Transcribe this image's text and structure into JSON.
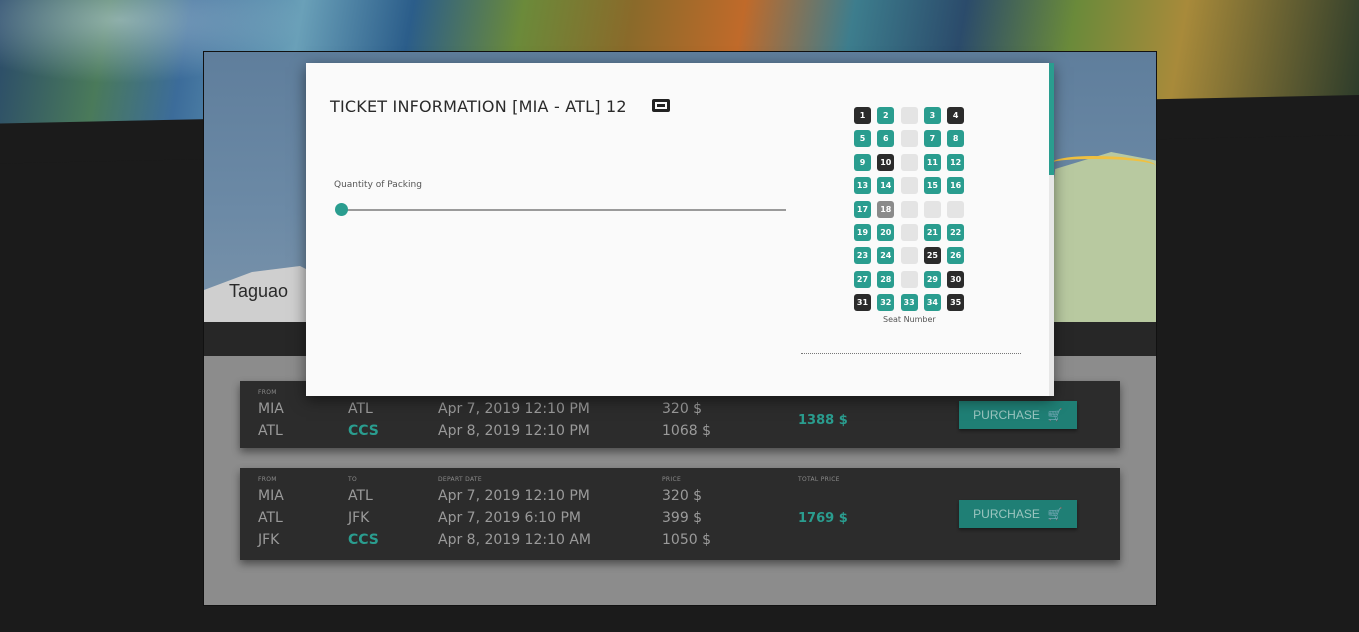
{
  "map": {
    "place_label": "Taguao"
  },
  "modal": {
    "title": "TICKET INFORMATION [MIA - ATL] 12",
    "quantity_label": "Quantity of Packing",
    "slider_value": 0,
    "seat_label": "Seat Number",
    "seats": [
      [
        "1",
        "taken"
      ],
      [
        "2",
        "avail"
      ],
      [
        "",
        "empty"
      ],
      [
        "3",
        "avail"
      ],
      [
        "4",
        "taken"
      ],
      [
        "5",
        "avail"
      ],
      [
        "6",
        "avail"
      ],
      [
        "",
        "empty"
      ],
      [
        "7",
        "avail"
      ],
      [
        "8",
        "avail"
      ],
      [
        "9",
        "avail"
      ],
      [
        "10",
        "taken"
      ],
      [
        "",
        "empty"
      ],
      [
        "11",
        "avail"
      ],
      [
        "12",
        "avail"
      ],
      [
        "13",
        "avail"
      ],
      [
        "14",
        "avail"
      ],
      [
        "",
        "empty"
      ],
      [
        "15",
        "avail"
      ],
      [
        "16",
        "avail"
      ],
      [
        "17",
        "avail"
      ],
      [
        "18",
        "sel"
      ],
      [
        "",
        "empty"
      ],
      [
        "",
        "empty"
      ],
      [
        "",
        "empty"
      ],
      [
        "19",
        "avail"
      ],
      [
        "20",
        "avail"
      ],
      [
        "",
        "empty"
      ],
      [
        "21",
        "avail"
      ],
      [
        "22",
        "avail"
      ],
      [
        "23",
        "avail"
      ],
      [
        "24",
        "avail"
      ],
      [
        "",
        "empty"
      ],
      [
        "25",
        "taken"
      ],
      [
        "26",
        "avail"
      ],
      [
        "27",
        "avail"
      ],
      [
        "28",
        "avail"
      ],
      [
        "",
        "empty"
      ],
      [
        "29",
        "avail"
      ],
      [
        "30",
        "taken"
      ],
      [
        "31",
        "taken"
      ],
      [
        "32",
        "avail"
      ],
      [
        "33",
        "avail"
      ],
      [
        "34",
        "avail"
      ],
      [
        "35",
        "taken"
      ]
    ]
  },
  "cards": [
    {
      "headers": {
        "from": "FROM"
      },
      "rows": [
        {
          "from": "MIA",
          "to": "ATL",
          "date": "Apr 7, 2019 12:10 PM",
          "price": "320 $"
        },
        {
          "from": "ATL",
          "to": "CCS",
          "date": "Apr 8, 2019 12:10 PM",
          "price": "1068 $"
        }
      ],
      "total": "1388 $",
      "purchase_label": "PURCHASE"
    },
    {
      "headers": {
        "from": "FROM",
        "to": "TO",
        "date": "DEPART DATE",
        "price": "PRICE",
        "total": "TOTAL PRICE"
      },
      "rows": [
        {
          "from": "MIA",
          "to": "ATL",
          "date": "Apr 7, 2019 12:10 PM",
          "price": "320 $"
        },
        {
          "from": "ATL",
          "to": "JFK",
          "date": "Apr 7, 2019 6:10 PM",
          "price": "399 $"
        },
        {
          "from": "JFK",
          "to": "CCS",
          "date": "Apr 8, 2019 12:10 AM",
          "price": "1050 $"
        }
      ],
      "total": "1769 $",
      "purchase_label": "PURCHASE"
    }
  ],
  "colors": {
    "accent": "#2a9d8f",
    "dark": "#2c2c2c"
  }
}
